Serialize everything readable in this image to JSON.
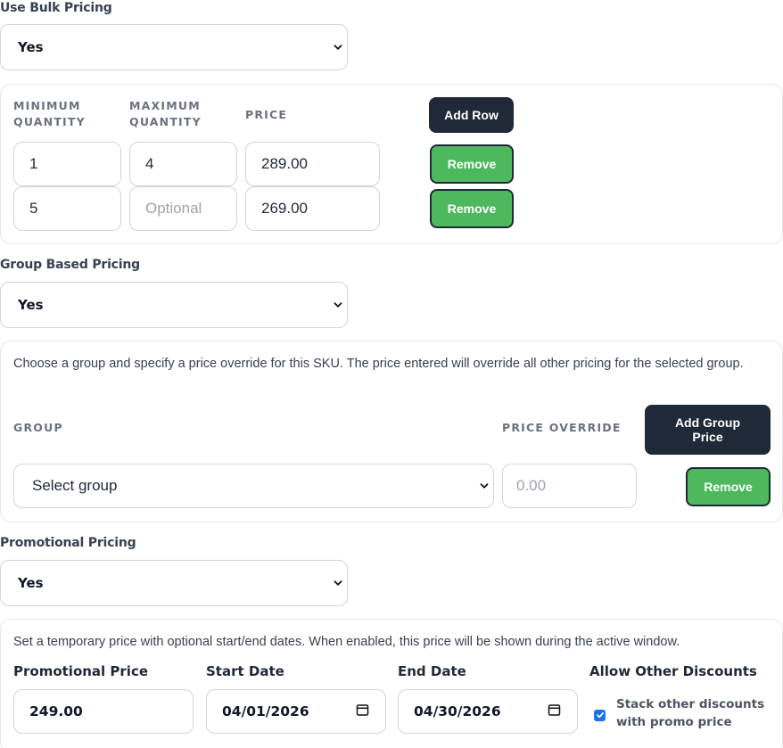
{
  "bulk_pricing": {
    "label": "Use Bulk Pricing",
    "selected": "Yes",
    "columns": {
      "min": "MINIMUM QUANTITY",
      "max": "MAXIMUM QUANTITY",
      "price": "PRICE"
    },
    "add_row_label": "Add Row",
    "rows": [
      {
        "min": "1",
        "max": "4",
        "max_placeholder": "",
        "price": "289.00",
        "remove_label": "Remove"
      },
      {
        "min": "5",
        "max": "",
        "max_placeholder": "Optional",
        "price": "269.00",
        "remove_label": "Remove"
      }
    ]
  },
  "group_pricing": {
    "label": "Group Based Pricing",
    "selected": "Yes",
    "description": "Choose a group and specify a price override for this SKU. The price entered will override all other pricing for the selected group.",
    "columns": {
      "group": "GROUP",
      "override": "PRICE OVERRIDE"
    },
    "add_label": "Add Group Price",
    "row": {
      "group": "Select group",
      "override_placeholder": "0.00",
      "remove_label": "Remove"
    }
  },
  "promo_pricing": {
    "label": "Promotional Pricing",
    "selected": "Yes",
    "description": "Set a temporary price with optional start/end dates. When enabled, this price will be shown during the active window.",
    "price_label": "Promotional Price",
    "price_value": "249.00",
    "start_label": "Start Date",
    "start_value": "04/01/2026",
    "end_label": "End Date",
    "end_value": "04/30/2026",
    "discount_label": "Allow Other Discounts",
    "stack_label": "Stack other discounts with promo price",
    "stack_checked": true
  },
  "colors": {
    "primary_dark": "#1f2937",
    "remove_green": "#4db85e",
    "checkbox_blue": "#1a73e8"
  }
}
